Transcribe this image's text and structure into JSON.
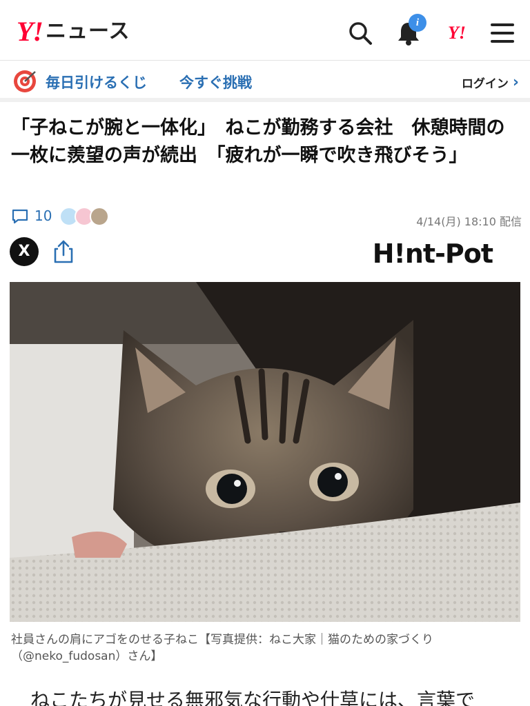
{
  "header": {
    "logo_mark": "Y!",
    "logo_text": "ニュース",
    "notification_badge": "i",
    "yj_mark": "Y!"
  },
  "promo": {
    "text": "毎日引けるくじ",
    "cta": "今すぐ挑戦",
    "login": "ログイン"
  },
  "article": {
    "title": "「子ねこが腕と一体化」　ねこが勤務する会社　休憩時間の一枚に羨望の声が続出　「疲れが一瞬で吹き飛びそう」",
    "comment_count": "10",
    "date": "4/14(月) 18:10 配信",
    "source": "H!nt-Pot",
    "x_label": "X",
    "caption": "社員さんの肩にアゴをのせる子ねこ【写真提供：ねこ大家｜猫のための家づくり（@neko_fudosan）さん】",
    "body_start": "ねこたちが見せる無邪気な行動や仕草には、言葉で"
  },
  "colors": {
    "brand_red": "#ff0033",
    "link_blue": "#2a6fb3",
    "badge_blue": "#3d8fe8"
  },
  "icons": [
    "search-icon",
    "bell-icon",
    "menu-icon",
    "target-icon",
    "comment-icon",
    "share-icon",
    "x-icon"
  ]
}
